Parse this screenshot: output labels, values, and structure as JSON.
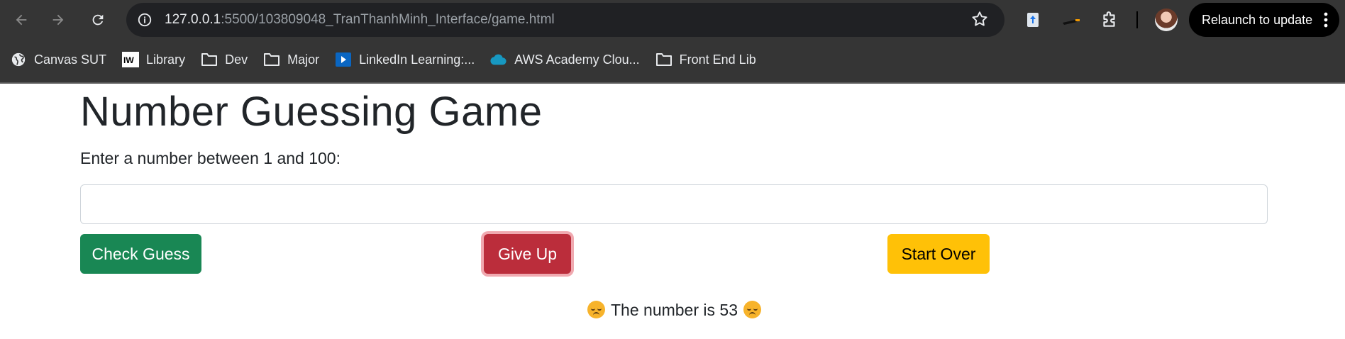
{
  "browser": {
    "url_host": "127.0.0.1",
    "url_rest": ":5500/103809048_TranThanhMinh_Interface/game.html",
    "relaunch_label": "Relaunch to update",
    "bookmarks": [
      {
        "label": "Canvas SUT",
        "icon": "globe-icon"
      },
      {
        "label": "Library",
        "icon": "iw-logo-icon"
      },
      {
        "label": "Dev",
        "icon": "folder-icon"
      },
      {
        "label": "Major",
        "icon": "folder-icon"
      },
      {
        "label": "LinkedIn Learning:...",
        "icon": "linkedin-learning-icon"
      },
      {
        "label": "AWS Academy Clou...",
        "icon": "cloud-icon"
      },
      {
        "label": "Front End Lib",
        "icon": "folder-icon"
      }
    ]
  },
  "page": {
    "title": "Number Guessing Game",
    "prompt": "Enter a number between 1 and 100:",
    "input_value": "",
    "buttons": {
      "check": "Check Guess",
      "give_up": "Give Up",
      "start_over": "Start Over"
    },
    "result_text": "The number is 53",
    "result_emoji": "disappointed-face-icon"
  },
  "colors": {
    "success": "#198754",
    "danger": "#bb2d3b",
    "warning": "#ffc107",
    "chrome": "#353535"
  }
}
